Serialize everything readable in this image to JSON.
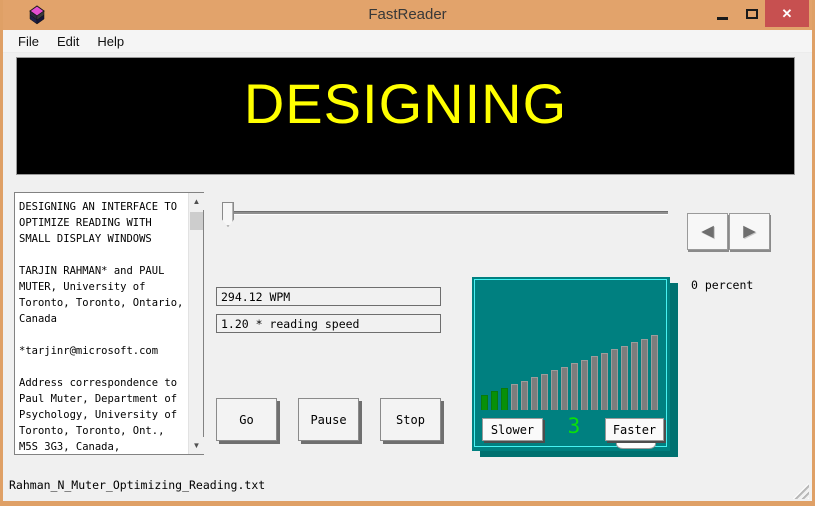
{
  "window": {
    "title": "FastReader",
    "icon": "book-stack",
    "controls": {
      "minimize": "minimize-icon",
      "maximize": "maximize-icon",
      "close_glyph": "✕"
    }
  },
  "menu": {
    "items": [
      {
        "label": "File"
      },
      {
        "label": "Edit"
      },
      {
        "label": "Help"
      }
    ]
  },
  "display": {
    "current_word": "DESIGNING",
    "bg_color": "#000000",
    "text_color": "#ffff00"
  },
  "document_panel": {
    "text": "DESIGNING AN INTERFACE TO\nOPTIMIZE READING WITH\nSMALL DISPLAY WINDOWS\n\nTARJIN RAHMAN* and PAUL\nMUTER, University of\nToronto, Toronto, Ontario,\nCanada\n\n*tarjinr@microsoft.com\n\nAddress correspondence to\nPaul Muter, Department of\nPsychology, University of\nToronto, Toronto, Ont.,\nM5S 3G3, Canada,",
    "scrollbar": {
      "up_glyph": "▲",
      "down_glyph": "▼"
    }
  },
  "progress": {
    "percent_label": "0 percent",
    "slider_position": 0,
    "prev_glyph": "◄",
    "next_glyph": "►"
  },
  "readouts": {
    "wpm": "294.12 WPM",
    "speed": "1.20 * reading speed"
  },
  "transport": {
    "go": "Go",
    "pause": "Pause",
    "stop": "Stop"
  },
  "speed_panel": {
    "slower_label": "Slower",
    "faster_label": "Faster",
    "level": "3",
    "bars": {
      "heights": [
        15,
        19,
        22,
        26,
        29,
        33,
        36,
        40,
        43,
        47,
        50,
        54,
        57,
        61,
        64,
        68,
        71,
        75
      ],
      "green_count": 3,
      "green_color": "#089008",
      "gray_color": "#7d7d7d"
    },
    "panel_bg": "#008080",
    "panel_border": "#47f2f2",
    "level_color": "#0ae00a"
  },
  "status_bar": {
    "filename": "Rahman_N_Muter_Optimizing_Reading.txt"
  },
  "colors": {
    "titlebar_bg": "#e2a36b",
    "window_border": "#dfa066",
    "close_button_bg": "#c75050",
    "window_bg": "#f0f0f0"
  }
}
